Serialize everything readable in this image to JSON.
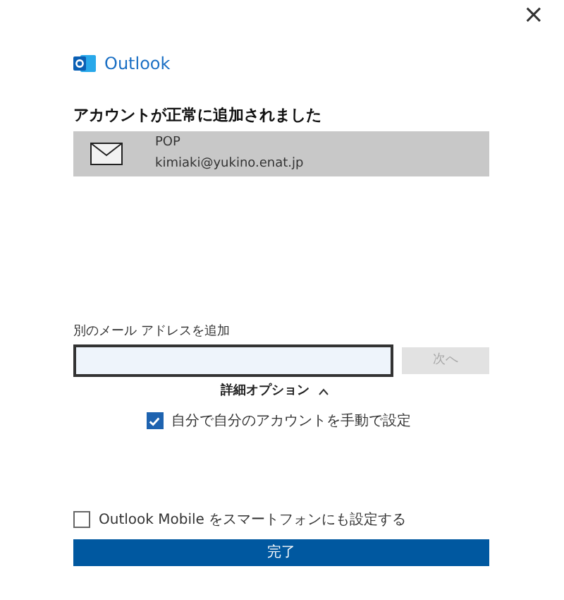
{
  "close_button": {
    "label": "×"
  },
  "brand": {
    "name": "Outlook"
  },
  "heading": "アカウントが正常に追加されました",
  "accounts": [
    {
      "type": "POP",
      "email": "kimiaki@yukino.enat.jp"
    }
  ],
  "add_email": {
    "label": "別のメール アドレスを追加",
    "next_button": {
      "label": "次へ",
      "disabled": true
    }
  },
  "advanced_options": {
    "label": "詳細オプション",
    "expanded": true
  },
  "options": [
    {
      "label": "自分で自分のアカウントを手動で設定",
      "checked": true
    }
  ],
  "mobile_option": {
    "label": "Outlook Mobile をスマートフォンにも設定する",
    "checked": false
  },
  "done_button": {
    "label": "完了"
  }
}
